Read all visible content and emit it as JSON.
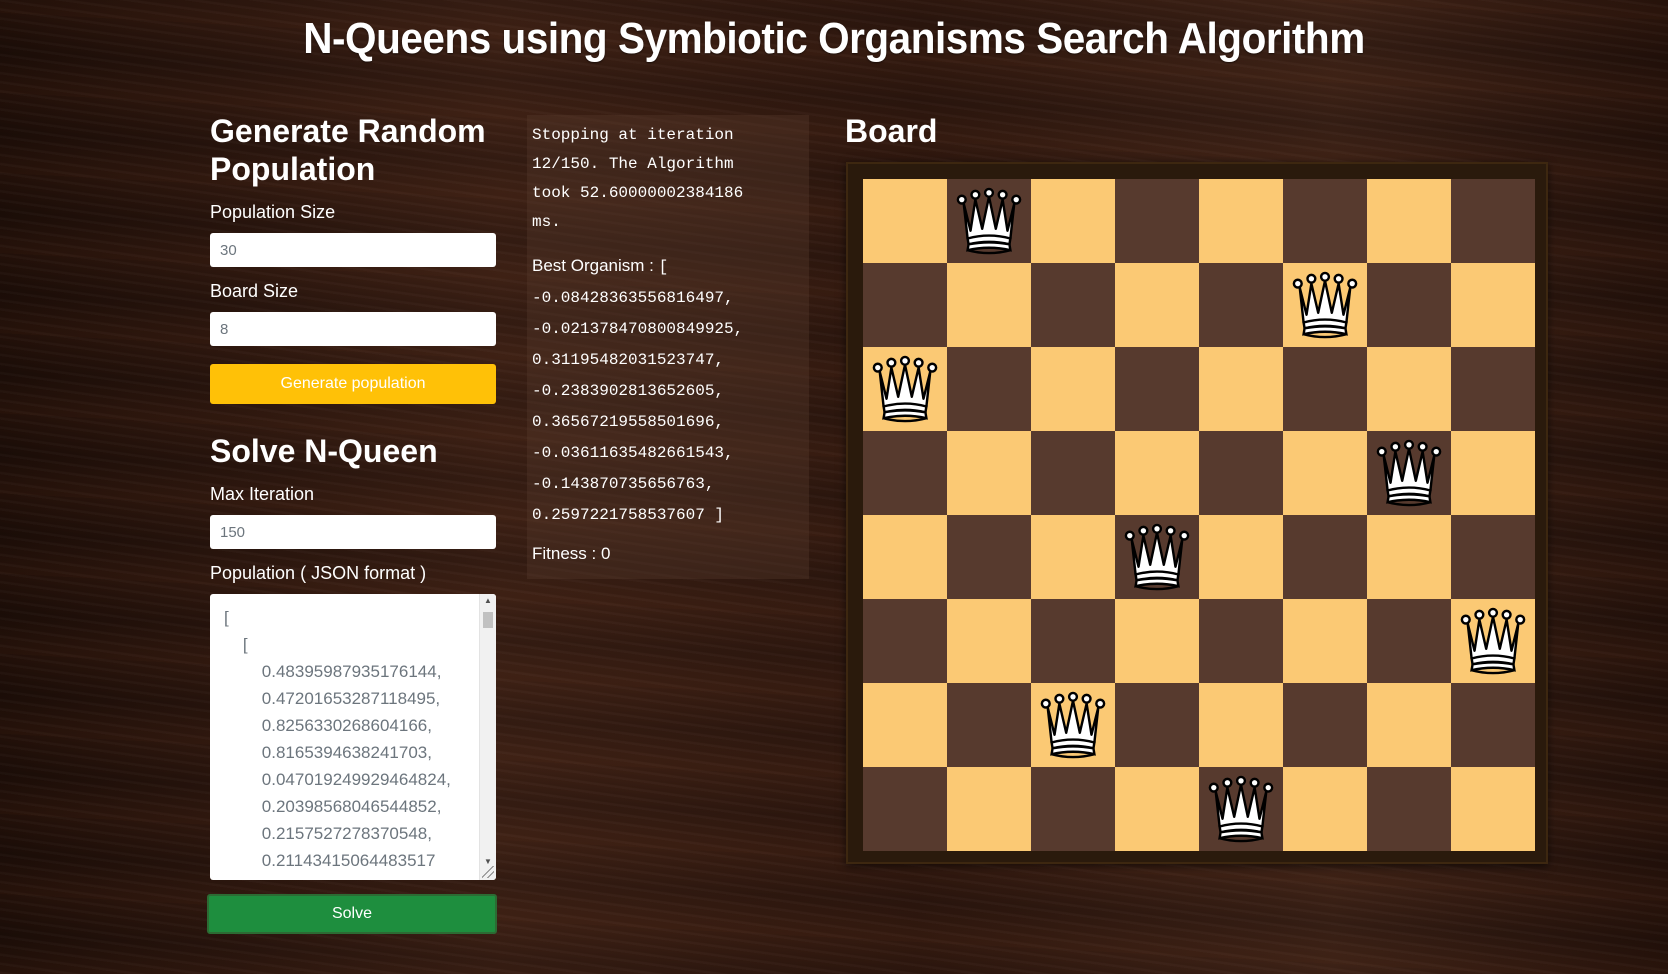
{
  "title": "N-Queens using Symbiotic Organisms Search Algorithm",
  "generate": {
    "heading": "Generate Random Population",
    "population_size_label": "Population Size",
    "population_size_value": "30",
    "board_size_label": "Board Size",
    "board_size_value": "8",
    "button_label": "Generate population"
  },
  "solve": {
    "heading": "Solve N-Queen",
    "max_iteration_label": "Max Iteration",
    "max_iteration_value": "150",
    "population_label": "Population ( JSON format )",
    "population_lines": [
      "[",
      "    [",
      "        0.48395987935176144,",
      "        0.47201653287118495,",
      "        0.8256330268604166,",
      "        0.8165394638241703,",
      "        0.047019249929464824,",
      "        0.20398568046544852,",
      "        0.2157527278370548,",
      "        0.21143415064483517"
    ],
    "button_label": "Solve"
  },
  "result": {
    "status": "Stopping at iteration\n12/150. The Algorithm\ntook 52.60000002384186\nms.",
    "best_label": "Best Organism :",
    "best_values": "[\n-0.08428363556816497,\n-0.021378470800849925,\n0.3119548203152374​7,\n-0.2383902813652605,\n0.36567219558501696,\n-0.03611635482661543,\n-0.143870735656763,\n0.2597221758537607 ]",
    "fitness_label": "Fitness :",
    "fitness_value": "0"
  },
  "board": {
    "title": "Board",
    "size": 8,
    "queen_icon": "queen-icon",
    "queens_col_by_row": [
      1,
      5,
      0,
      6,
      3,
      7,
      2,
      4
    ],
    "colors": {
      "light": "#fbc974",
      "dark": "#573a2e"
    }
  }
}
